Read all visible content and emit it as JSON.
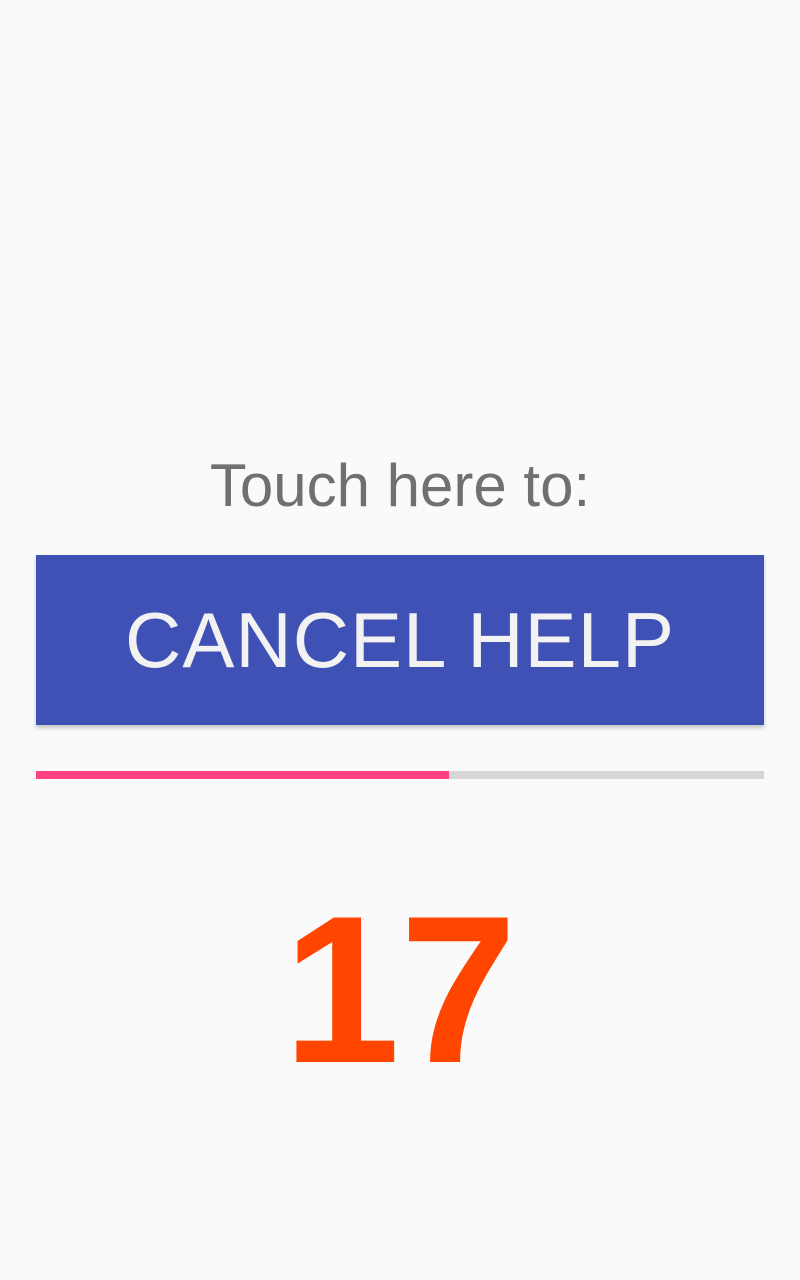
{
  "prompt_text": "Touch here to:",
  "cancel_button": {
    "label": "CANCEL HELP"
  },
  "progress": {
    "fraction": 0.567,
    "fill_color": "#ff4081",
    "track_color": "#d6d6d6"
  },
  "countdown": {
    "value": "17",
    "color": "#ff4500"
  },
  "colors": {
    "background": "#fafafa",
    "button": "#3f51b5",
    "button_text": "#f2f2f2",
    "prompt_text": "#707070"
  }
}
